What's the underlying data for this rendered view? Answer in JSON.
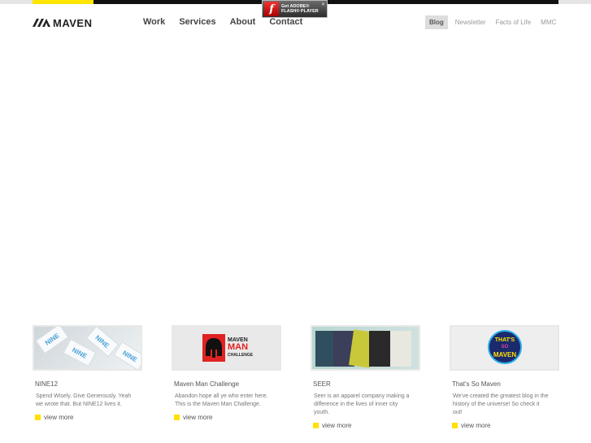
{
  "brand": {
    "name": "MAVEN",
    "logo_icon": "maven-chevron-icon",
    "accent": "#ffe500"
  },
  "nav": {
    "main": [
      "Work",
      "Services",
      "About",
      "Contact"
    ],
    "secondary": [
      {
        "label": "Blog",
        "active": true
      },
      {
        "label": "Newsletter",
        "active": false
      },
      {
        "label": "Facts of Life",
        "active": false
      },
      {
        "label": "MMC",
        "active": false
      }
    ]
  },
  "flash_badge": {
    "line1": "Get ADOBE®",
    "line2": "FLASH® PLAYER",
    "icon": "flash-player-icon"
  },
  "cards": [
    {
      "title": "NINE12",
      "desc": "Spend Wisely. Give Generously. Yeah we wrote that. But NINE12 lives it.",
      "link": "view more",
      "thumb_text": "NINE"
    },
    {
      "title": "Maven Man Challenge",
      "desc": "Abandon hope all ye who enter here. This is the Maven Man Challenge.",
      "link": "view more",
      "thumb_line1": "MAVEN",
      "thumb_line2": "MAN",
      "thumb_line3": "CHALLENGE"
    },
    {
      "title": "SEER",
      "desc": "Seer is an apparel company making a difference in the lives of inner city youth.",
      "link": "view more"
    },
    {
      "title": "That's So Maven",
      "desc": "We've created the greatest blog in the history of the universe! So check it out!",
      "link": "view more",
      "thumb_line1": "THAT'S",
      "thumb_line2": "SO",
      "thumb_line3": "MAVEN"
    }
  ]
}
